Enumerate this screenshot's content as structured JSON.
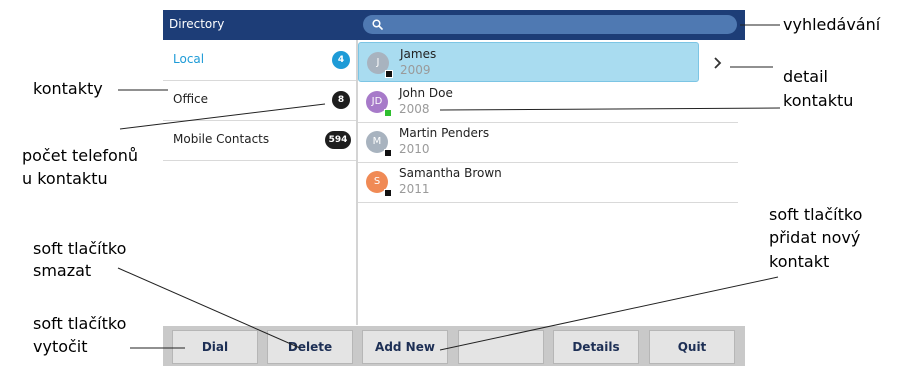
{
  "directory": {
    "title": "Directory",
    "search_icon": "search-icon",
    "categories": [
      {
        "label": "Local",
        "count": "4",
        "active": true
      },
      {
        "label": "Office",
        "count": "8",
        "active": false
      },
      {
        "label": "Mobile Contacts",
        "count": "594",
        "active": false
      }
    ],
    "contacts": [
      {
        "initial": "J",
        "name": "James",
        "number": "2009",
        "avatar_color": "#a8b3bf",
        "status_color": "#111111",
        "selected": true
      },
      {
        "initial": "JD",
        "name": "John Doe",
        "number": "2008",
        "avatar_color": "#a77ac9",
        "status_color": "#2fbf2f",
        "selected": false
      },
      {
        "initial": "M",
        "name": "Martin Penders",
        "number": "2010",
        "avatar_color": "#a8b3bf",
        "status_color": "#111111",
        "selected": false
      },
      {
        "initial": "S",
        "name": "Samantha Brown",
        "number": "2011",
        "avatar_color": "#f08a55",
        "status_color": "#111111",
        "selected": false
      }
    ],
    "detail_icon": "chevron-right-icon",
    "softkeys": [
      "Dial",
      "Delete",
      "Add New",
      "",
      "Details",
      "Quit"
    ]
  },
  "annotations": {
    "search": "vyhledávání",
    "contacts": "kontakty",
    "detail_line1": "detail",
    "detail_line2": "kontaktu",
    "count_line1": "počet telefonů",
    "count_line2": "u kontaktu",
    "delete_line1": "soft tlačítko",
    "delete_line2": "smazat",
    "dial_line1": "soft tlačítko",
    "dial_line2": "vytočit",
    "addnew_line1": "soft tlačítko",
    "addnew_line2": "přidat nový",
    "addnew_line3": "kontakt"
  },
  "colors": {
    "header": "#1d3d77",
    "search_field": "#4f79b2",
    "accent": "#1e9bd7",
    "selected_row": "#a9dcf0",
    "softkey_bar": "#c9c9c9"
  }
}
